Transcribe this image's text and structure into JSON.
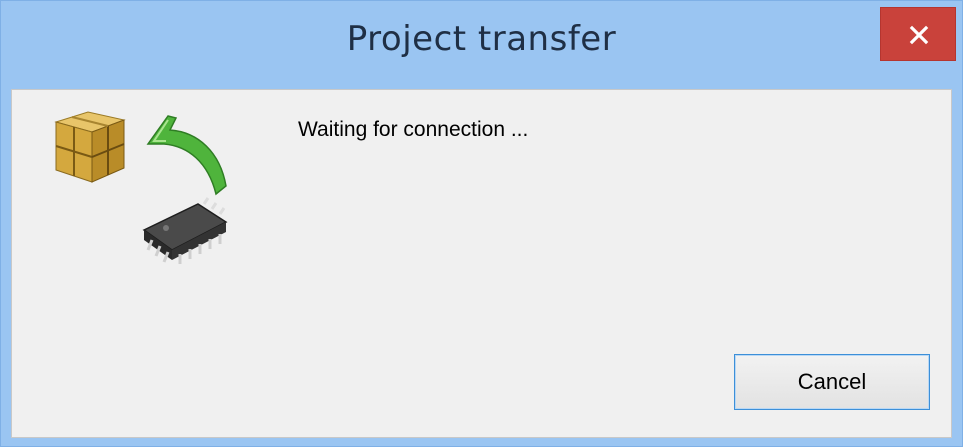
{
  "window": {
    "title": "Project transfer",
    "close_icon": "close-icon"
  },
  "content": {
    "status_message": "Waiting for connection ...",
    "icons": [
      "package-cube-icon",
      "green-arrow-icon",
      "chip-icon"
    ]
  },
  "buttons": {
    "cancel_label": "Cancel"
  },
  "colors": {
    "titlebar": "#9ac5f2",
    "close_button": "#c9423b",
    "client_background": "#f0f0f0",
    "button_focus_border": "#3c8fd8"
  }
}
